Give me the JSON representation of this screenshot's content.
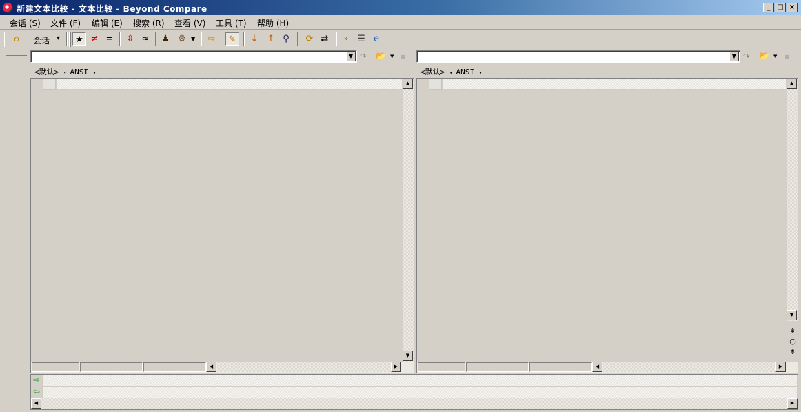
{
  "window": {
    "title": "新建文本比较 - 文本比较 - Beyond Compare",
    "minimize": "_",
    "maximize": "□",
    "close": "×"
  },
  "menu": [
    {
      "label": "会话 (S)"
    },
    {
      "label": "文件 (F)"
    },
    {
      "label": "编辑 (E)"
    },
    {
      "label": "搜索 (R)"
    },
    {
      "label": "查看 (V)"
    },
    {
      "label": "工具 (T)"
    },
    {
      "label": "帮助 (H)"
    }
  ],
  "toolbar": {
    "session_label": "会话",
    "session_arrow": "▾",
    "icons": {
      "home": "home-icon",
      "all": "show-all-icon",
      "diffs": "show-differences-icon",
      "same": "show-same-icon",
      "context": "context-icon",
      "minor": "ignore-minor-icon",
      "rules": "rules-icon",
      "format": "format-icon",
      "next_section": "next-section-icon",
      "edit": "edit-icon",
      "next_diff": "next-difference-icon",
      "prev_diff": "previous-difference-icon",
      "find": "find-icon",
      "swap": "swap-sides-icon",
      "copy": "copy-icon",
      "more": "more-icon",
      "report": "report-icon",
      "web": "web-icon"
    }
  },
  "left": {
    "path_value": "",
    "encoding_default": "<默认>",
    "encoding_charset": "ANSI"
  },
  "right": {
    "path_value": "",
    "encoding_default": "<默认>",
    "encoding_charset": "ANSI"
  },
  "colors": {
    "title_gradient_start": "#0a246a",
    "title_gradient_end": "#a6caf0",
    "face": "#d4d0c8"
  }
}
